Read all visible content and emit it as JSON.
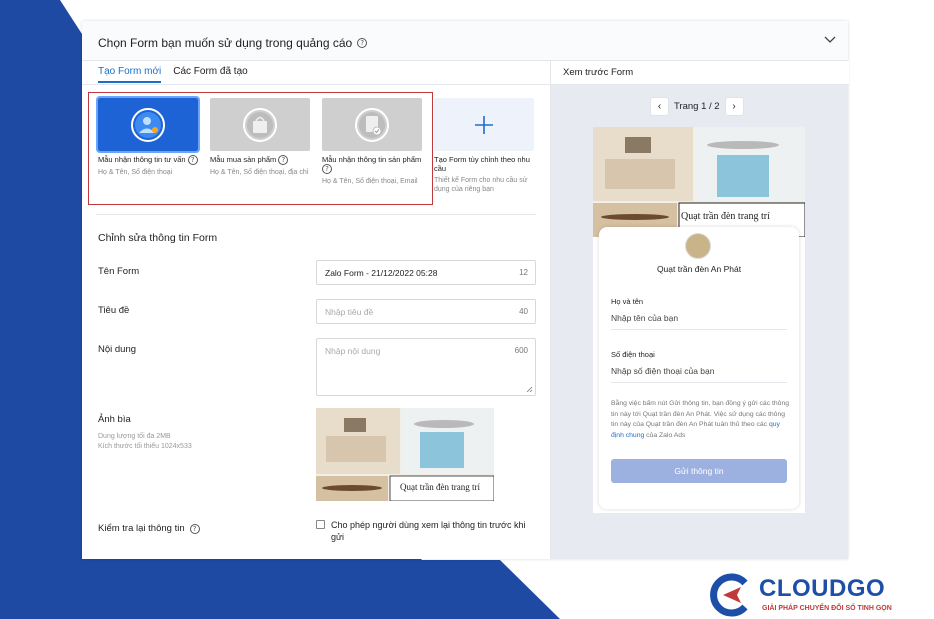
{
  "header": {
    "title": "Chọn Form bạn muốn sử dụng trong quảng cáo"
  },
  "tabs": [
    {
      "label": "Tạo Form mới",
      "active": true
    },
    {
      "label": "Các Form đã tạo",
      "active": false
    }
  ],
  "templates": [
    {
      "name": "Mẫu nhận thông tin tư vấn",
      "desc": "Họ & Tên, Số điện thoại",
      "icon": "person-icon",
      "selected": true
    },
    {
      "name": "Mẫu mua sản phẩm",
      "desc": "Họ & Tên, Số điện thoại, địa chỉ",
      "icon": "shopping-bag-icon",
      "selected": false
    },
    {
      "name": "Mẫu nhận thông tin sản phẩm",
      "desc": "Họ & Tên, Số điện thoại, Email",
      "icon": "document-icon",
      "selected": false
    },
    {
      "name": "Tạo Form tùy chỉnh theo nhu cầu",
      "desc": "Thiết kế Form cho nhu cầu sử dụng của riêng bạn",
      "icon": "plus-icon",
      "selected": false
    }
  ],
  "edit": {
    "title": "Chỉnh sửa thông tin Form",
    "form_name_label": "Tên Form",
    "form_name_value": "Zalo Form - 21/12/2022 05:28",
    "form_name_counter": "12",
    "subject_label": "Tiêu đề",
    "subject_placeholder": "Nhập tiêu đề",
    "subject_counter": "40",
    "content_label": "Nội dung",
    "content_placeholder": "Nhập nội dung",
    "content_counter": "600",
    "cover_label": "Ảnh bìa",
    "cover_note1": "Dung lượng tối đa 2MB",
    "cover_note2": "Kích thước tối thiểu 1024x533",
    "cover_caption": "Quạt trần đèn trang trí",
    "review_label": "Kiểm tra lại thông tin",
    "review_checkbox": "Cho phép người dùng xem lại thông tin trước khi gửi"
  },
  "preview": {
    "title": "Xem trước Form",
    "page": "Trang 1 / 2",
    "brand": "Quạt trần đèn An Phát",
    "name_label": "Họ và tên",
    "name_placeholder": "Nhập tên của bạn",
    "phone_label": "Số điện thoại",
    "phone_placeholder": "Nhập số điện thoại của bạn",
    "policy_before": "Bằng việc bấm nút Gửi thông tin, bạn đồng ý gửi các thông tin này tới Quạt trần đèn An Phát. Việc sử dụng các thông tin này của Quạt trần đèn An Phát tuân thủ theo các ",
    "policy_link": "quy định chung",
    "policy_after": " của Zalo Ads",
    "submit": "Gửi thông tin",
    "cover_caption": "Quạt trần đèn trang trí"
  },
  "logo": {
    "name": "CLOUDGO",
    "tagline": "GIẢI PHÁP CHUYỂN ĐỔI SỐ TINH GỌN"
  },
  "colors": {
    "accent": "#1a6fc9",
    "selected_template": "#1e63d6",
    "highlight_border": "#c0393b",
    "background_shape": "#1f4aa3"
  }
}
